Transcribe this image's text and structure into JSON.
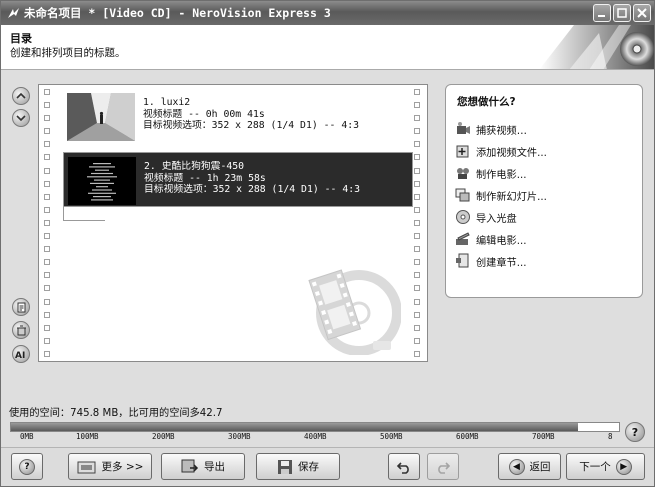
{
  "window": {
    "title": "未命名项目 * [Video CD] - NeroVision Express 3"
  },
  "header": {
    "title": "目录",
    "subtitle": "创建和排列项目的标题。"
  },
  "titles": [
    {
      "line1": "1. luxi2",
      "line2": "视频标题 -- 0h 00m 41s",
      "line3": "目标视频选项：352 x 288 (1/4 D1) -- 4:3",
      "selected": false
    },
    {
      "line1": "2. 史酷比狗狗震-450",
      "line2": "视频标题 -- 1h 23m 58s",
      "line3": "目标视频选项：352 x 288 (1/4 D1) -- 4:3",
      "selected": true
    }
  ],
  "tasks": {
    "title": "您想做什么?",
    "items": [
      {
        "label": "捕获视频…",
        "icon": "camera-icon"
      },
      {
        "label": "添加视频文件...",
        "icon": "add-video-icon"
      },
      {
        "label": "制作电影...",
        "icon": "film-icon"
      },
      {
        "label": "制作新幻灯片...",
        "icon": "slideshow-icon"
      },
      {
        "label": "导入光盘",
        "icon": "disc-import-icon"
      },
      {
        "label": "编辑电影...",
        "icon": "edit-movie-icon"
      },
      {
        "label": "创建章节...",
        "icon": "chapter-icon"
      }
    ]
  },
  "space": {
    "text": "使用的空间：745.8 MB，比可用的空间多42.7",
    "used_mb": 745.8,
    "max_mb": 800,
    "ticks": [
      "0MB",
      "100MB",
      "200MB",
      "300MB",
      "400MB",
      "500MB",
      "600MB",
      "700MB",
      "8"
    ]
  },
  "buttons": {
    "more": "更多 >>",
    "export": "导出",
    "save": "保存",
    "back": "返回",
    "next": "下一个"
  },
  "colors": {
    "selection": "#2b2b2b",
    "titlebar": "#6a6a6a"
  }
}
